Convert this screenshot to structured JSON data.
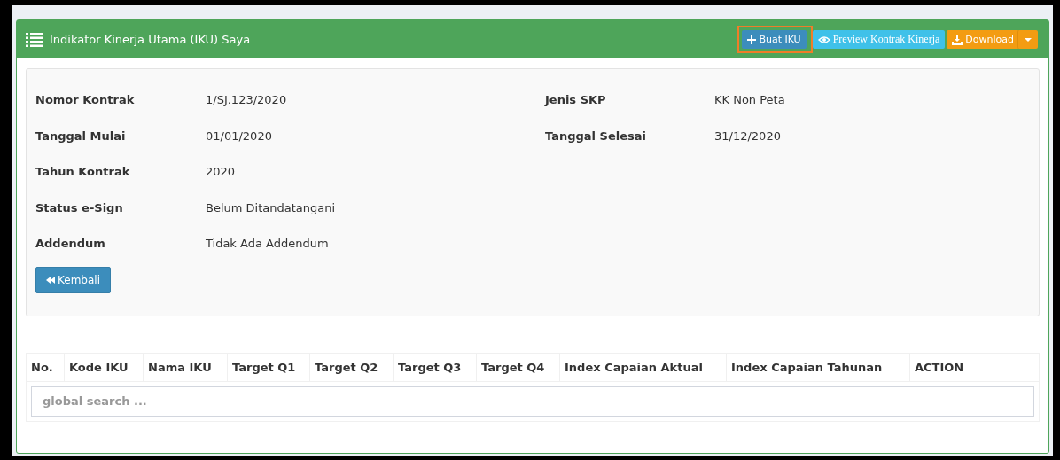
{
  "panel": {
    "title": "Indikator Kinerja Utama (IKU) Saya",
    "buttons": [
      {
        "kind": "primary",
        "label": "Buat IKU",
        "highlighted": true
      },
      {
        "kind": "info",
        "label": "Preview Kontrak Kinerja",
        "highlighted": false
      },
      {
        "kind": "warning",
        "label": "Download",
        "highlighted": false
      }
    ]
  },
  "details": {
    "left": [
      {
        "label": "Nomor Kontrak",
        "value": "1/SJ.123/2020"
      },
      {
        "label": "Tanggal Mulai",
        "value": "01/01/2020"
      },
      {
        "label": "Tahun Kontrak",
        "value": "2020"
      },
      {
        "label": "Status e-Sign",
        "value": "Belum Ditandatangani"
      },
      {
        "label": "Addendum",
        "value": "Tidak Ada Addendum"
      }
    ],
    "right": [
      {
        "label": "Jenis SKP",
        "value": "KK Non Peta"
      },
      {
        "label": "Tanggal Selesai",
        "value": "31/12/2020"
      }
    ],
    "back_button": "Kembali"
  },
  "table": {
    "columns": [
      "No.",
      "Kode IKU",
      "Nama IKU",
      "Target Q1",
      "Target Q2",
      "Target Q3",
      "Target Q4",
      "Index Capaian Aktual",
      "Index Capaian Tahunan",
      "ACTION"
    ],
    "search": {
      "placeholder": "global search ..."
    }
  }
}
